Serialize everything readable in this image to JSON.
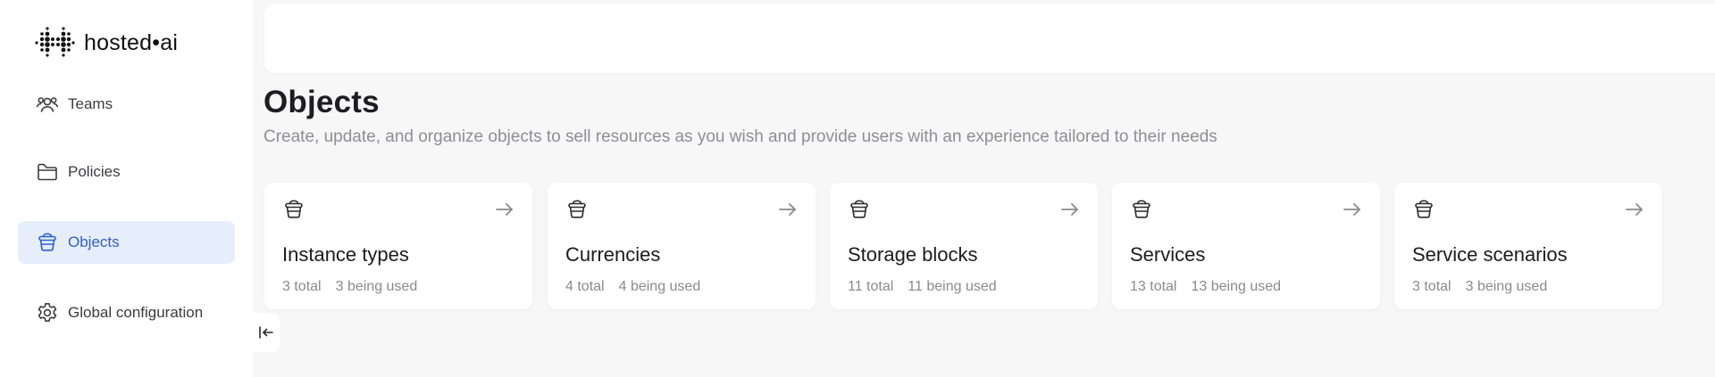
{
  "brand": {
    "name": "hosted•ai",
    "logo_icon": "dotted-grid-logo"
  },
  "sidebar": {
    "items": [
      {
        "label": "Teams",
        "icon": "users-icon"
      },
      {
        "label": "Policies",
        "icon": "folder-icon"
      },
      {
        "label": "Objects",
        "icon": "bucket-icon",
        "active": true
      },
      {
        "label": "Global configuration",
        "icon": "gear-icon"
      }
    ],
    "collapse_icon": "collapse-left-icon"
  },
  "page": {
    "title": "Objects",
    "subtitle": "Create, update, and organize objects to sell resources as you wish and provide users with an experience tailored to their needs"
  },
  "cards": [
    {
      "title": "Instance types",
      "total": "3 total",
      "used": "3 being used",
      "icon": "bucket-icon"
    },
    {
      "title": "Currencies",
      "total": "4 total",
      "used": "4 being used",
      "icon": "bucket-icon"
    },
    {
      "title": "Storage blocks",
      "total": "11 total",
      "used": "11 being used",
      "icon": "bucket-icon"
    },
    {
      "title": "Services",
      "total": "13 total",
      "used": "13 being used",
      "icon": "bucket-icon"
    },
    {
      "title": "Service scenarios",
      "total": "3 total",
      "used": "3 being used",
      "icon": "bucket-icon"
    }
  ],
  "colors": {
    "accent": "#2b5ed6",
    "active_bg": "#e7eefb",
    "background": "#f7f7f8",
    "muted_text": "#8e8e93"
  }
}
